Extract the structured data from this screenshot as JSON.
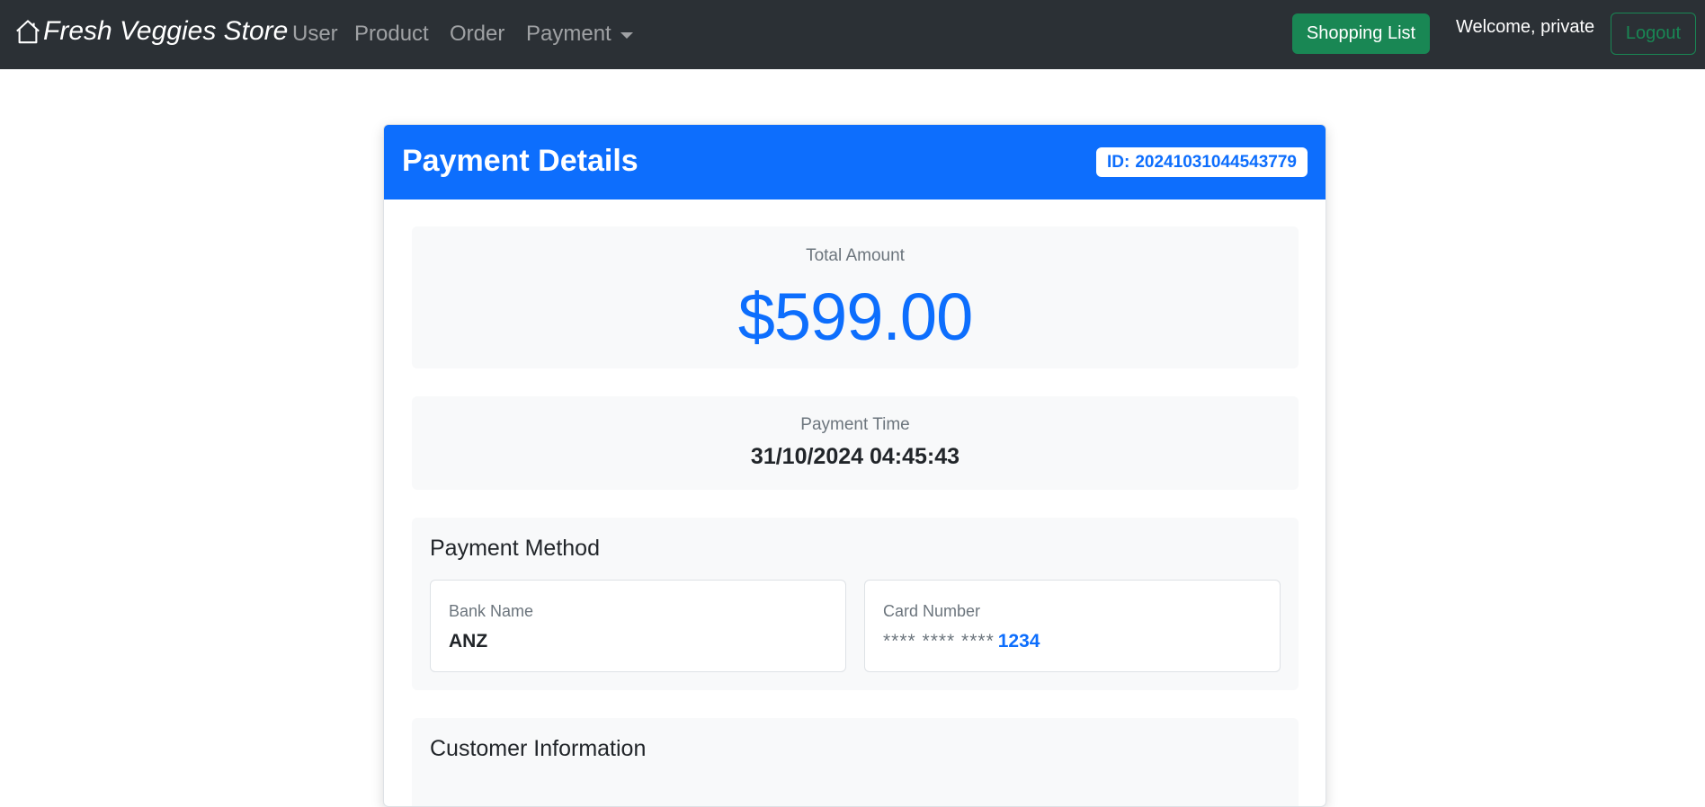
{
  "navbar": {
    "brand": "Fresh Veggies Store",
    "links": {
      "user": "User",
      "product": "Product",
      "order": "Order",
      "payment": "Payment"
    },
    "shopping_list_label": "Shopping List",
    "welcome_text": "Welcome, private",
    "logout_label": "Logout"
  },
  "payment": {
    "title": "Payment Details",
    "id_prefix": "ID:",
    "id": "20241031044543779",
    "total_amount_label": "Total Amount",
    "total_amount": "$599.00",
    "payment_time_label": "Payment Time",
    "payment_time": "31/10/2024 04:45:43",
    "method": {
      "title": "Payment Method",
      "bank_name_label": "Bank Name",
      "bank_name": "ANZ",
      "card_number_label": "Card Number",
      "card_mask": "**** **** ****",
      "card_last4": "1234"
    },
    "customer": {
      "title": "Customer Information"
    }
  },
  "colors": {
    "navbar_bg": "#2b3035",
    "primary": "#0d6efd",
    "success": "#198754",
    "panel_bg": "#f8f9fa"
  },
  "icons": {
    "brand": "house-icon",
    "payment_dropdown": "caret-down-icon"
  }
}
